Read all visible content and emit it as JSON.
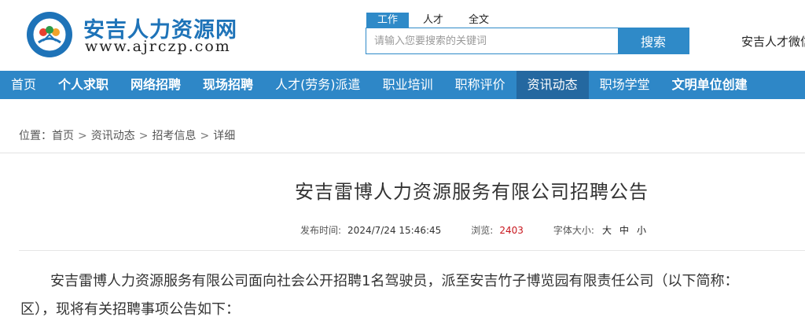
{
  "header": {
    "site_name": "安吉人力资源网",
    "site_url": "www.ajrczp.com",
    "wechat_link": "安吉人才微信"
  },
  "search": {
    "tabs": [
      {
        "label": "工作",
        "active": true
      },
      {
        "label": "人才",
        "active": false
      },
      {
        "label": "全文",
        "active": false
      }
    ],
    "placeholder": "请输入您要搜索的关键词",
    "button_label": "搜索"
  },
  "nav": {
    "items": [
      {
        "label": "首页",
        "bold": false,
        "active": false
      },
      {
        "label": "个人求职",
        "bold": true,
        "active": false
      },
      {
        "label": "网络招聘",
        "bold": true,
        "active": false
      },
      {
        "label": "现场招聘",
        "bold": true,
        "active": false
      },
      {
        "label": "人才(劳务)派遣",
        "bold": false,
        "active": false
      },
      {
        "label": "职业培训",
        "bold": false,
        "active": false
      },
      {
        "label": "职称评价",
        "bold": false,
        "active": false
      },
      {
        "label": "资讯动态",
        "bold": false,
        "active": true
      },
      {
        "label": "职场学堂",
        "bold": false,
        "active": false
      },
      {
        "label": "文明单位创建",
        "bold": true,
        "active": false
      }
    ]
  },
  "breadcrumb": {
    "prefix": "位置：",
    "items": [
      "首页",
      "资讯动态",
      "招考信息",
      "详细"
    ],
    "separator": ">"
  },
  "article": {
    "title": "安吉雷博人力资源服务有限公司招聘公告",
    "meta": {
      "publish_label": "发布时间:",
      "publish_time": "2024/7/24 15:46:45",
      "views_label": "浏览:",
      "views": "2403",
      "font_label": "字体大小:",
      "font_large": "大",
      "font_medium": "中",
      "font_small": "小"
    },
    "paragraph_line1": "安吉雷博人力资源服务有限公司面向社会公开招聘1名驾驶员，派至安吉竹子博览园有限责任公司（以下简称：",
    "paragraph_line2": "区），现将有关招聘事项公告如下："
  },
  "colors": {
    "brand_blue": "#2e87c7",
    "nav_active": "#2468a0",
    "views_red": "#c8161d"
  },
  "icons": {
    "logo": "emblem-logo-icon"
  }
}
